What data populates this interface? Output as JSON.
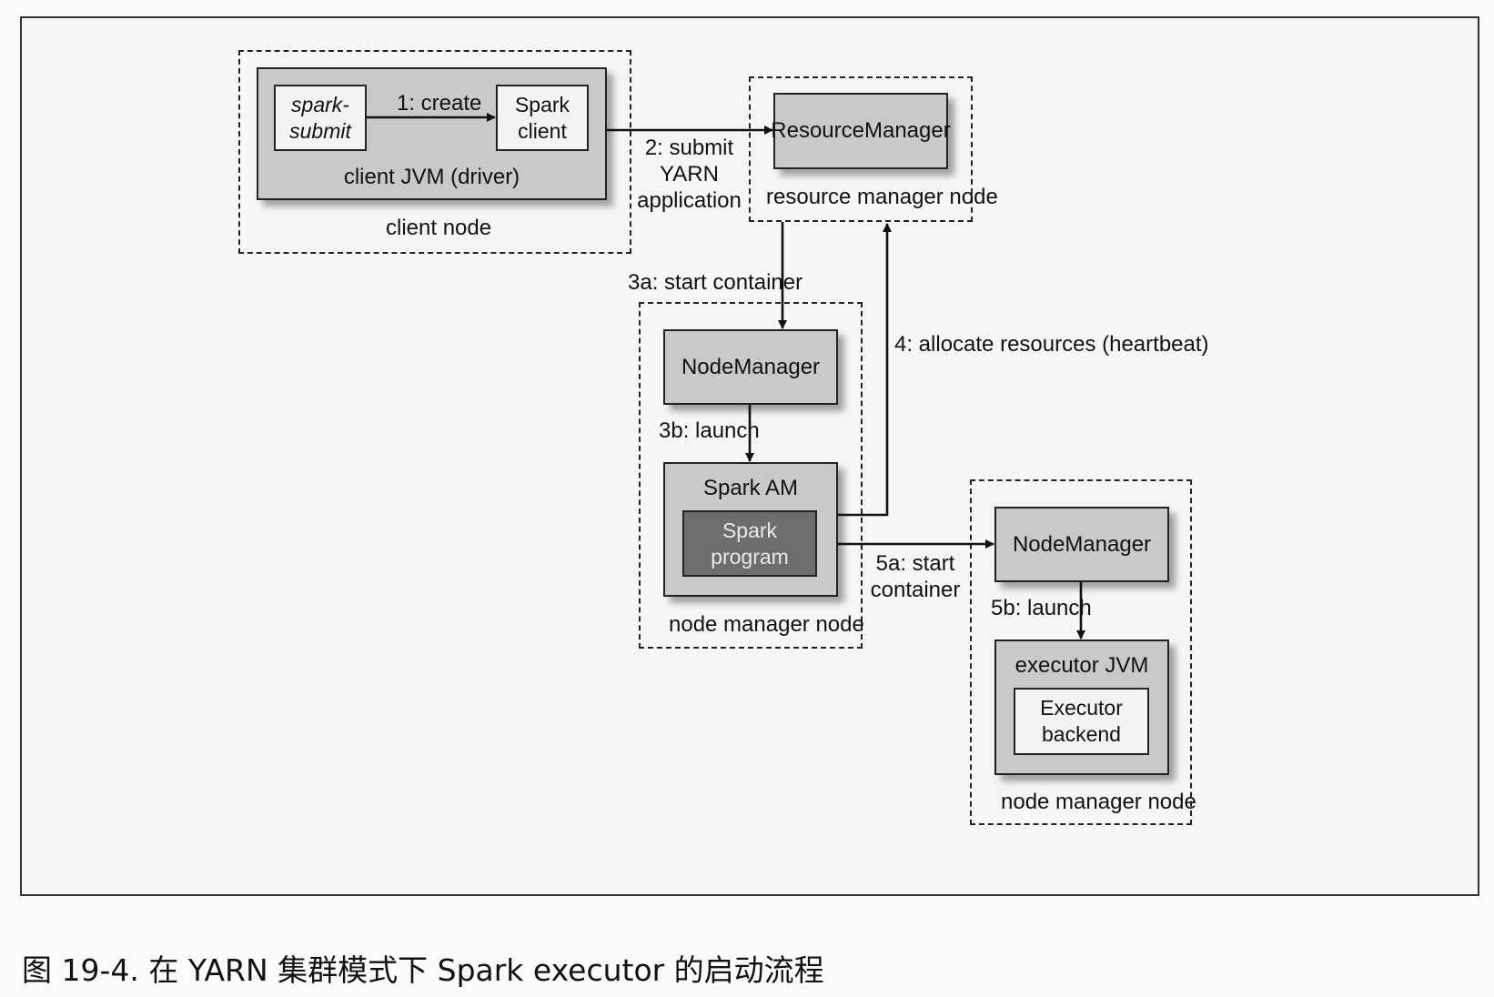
{
  "diagram": {
    "client_node": {
      "label": "client node",
      "jvm_label": "client JVM (driver)",
      "spark_submit": "spark-\nsubmit",
      "spark_client": "Spark\nclient"
    },
    "resource_manager_node": {
      "label": "resource manager node",
      "box": "ResourceManager"
    },
    "node_manager_node_1": {
      "label": "node manager node",
      "node_manager": "NodeManager",
      "spark_am": "Spark AM",
      "spark_program": "Spark\nprogram"
    },
    "node_manager_node_2": {
      "label": "node manager node",
      "node_manager": "NodeManager",
      "executor_jvm": "executor JVM",
      "executor_backend": "Executor\nbackend"
    },
    "edges": {
      "create": "1: create",
      "submit": "2: submit\nYARN\napplication",
      "start_container_3a": "3a: start container",
      "allocate": "4: allocate resources (heartbeat)",
      "launch_3b": "3b: launch",
      "start_container_5a": "5a: start\ncontainer",
      "launch_5b": "5b: launch"
    }
  },
  "caption": "图 19-4. 在 YARN 集群模式下 Spark executor 的启动流程"
}
